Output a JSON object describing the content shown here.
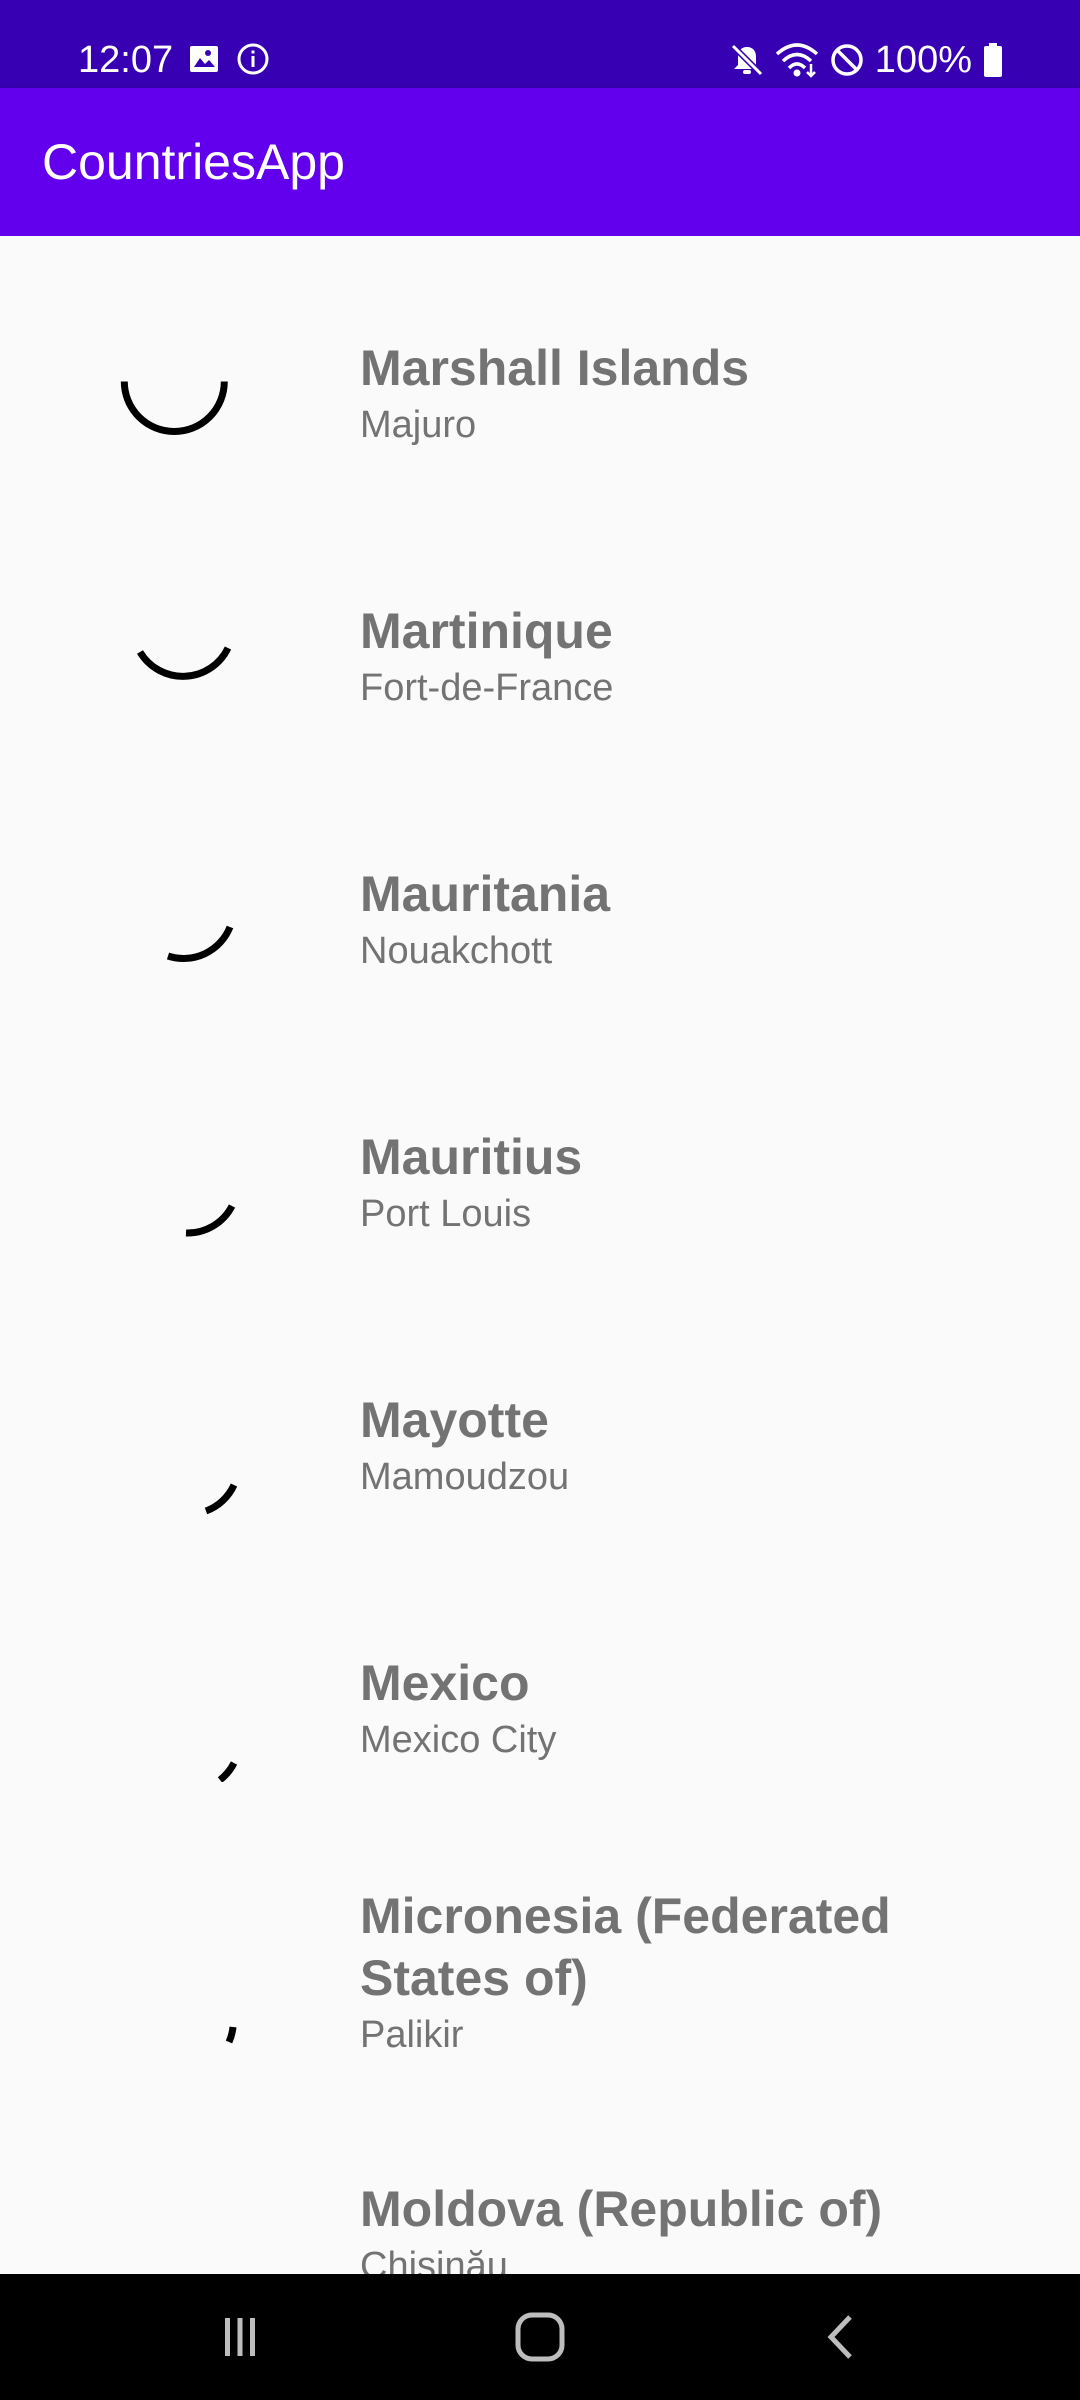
{
  "status_bar": {
    "time": "12:07",
    "battery_text": "100%",
    "icons_left": [
      "image-icon",
      "info-icon"
    ],
    "icons_right": [
      "mute-icon",
      "wifi-icon",
      "block-icon",
      "battery-icon"
    ]
  },
  "app_bar": {
    "title": "CountriesApp"
  },
  "countries": [
    {
      "name": "Marshall Islands",
      "capital": "Majuro"
    },
    {
      "name": "Martinique",
      "capital": "Fort-de-France"
    },
    {
      "name": "Mauritania",
      "capital": "Nouakchott"
    },
    {
      "name": "Mauritius",
      "capital": "Port Louis"
    },
    {
      "name": "Mayotte",
      "capital": "Mamoudzou"
    },
    {
      "name": "Mexico",
      "capital": "Mexico City"
    },
    {
      "name": "Micronesia (Federated States of)",
      "capital": "Palikir"
    },
    {
      "name": "Moldova (Republic of)",
      "capital": "Chișinău"
    }
  ],
  "nav_bar": {
    "buttons": [
      "recents-icon",
      "home-icon",
      "back-icon"
    ]
  }
}
